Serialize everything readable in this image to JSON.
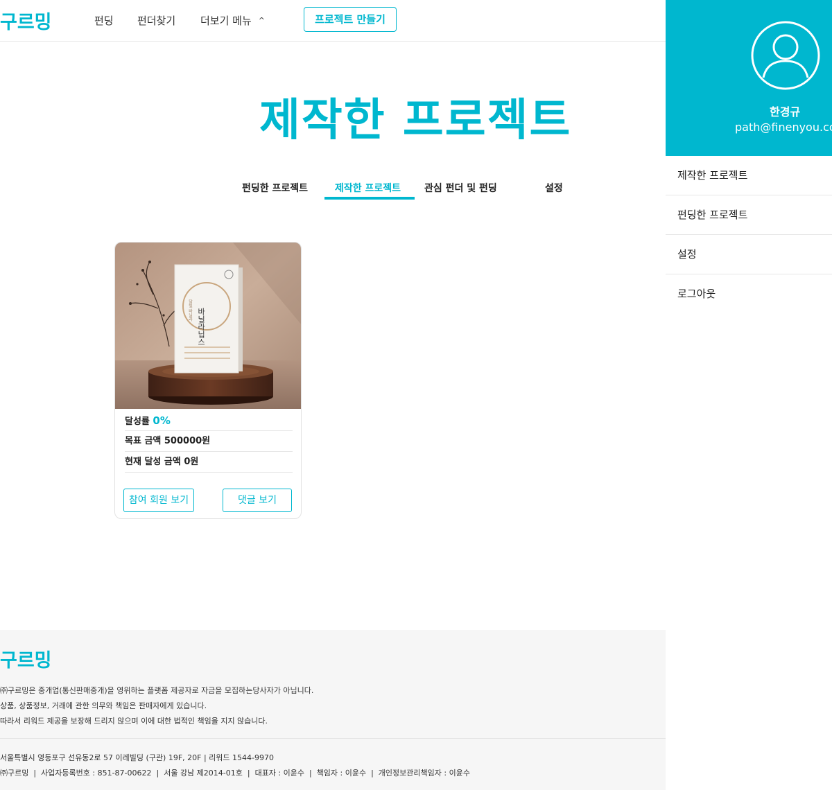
{
  "header": {
    "logo": "구르밍",
    "nav": [
      {
        "label": "펀딩"
      },
      {
        "label": "펀더찾기"
      },
      {
        "label": "더보기 메뉴"
      }
    ],
    "more_chevron_icon": "chevron-up-icon",
    "create_button": "프로젝트 만들기"
  },
  "page": {
    "title": "제작한 프로젝트",
    "tabs": [
      {
        "label": "펀딩한 프로젝트",
        "active": false
      },
      {
        "label": "제작한 프로젝트",
        "active": true
      },
      {
        "label": "관심 펀더 및 펀딩",
        "active": false
      },
      {
        "label": "설정",
        "active": false
      }
    ]
  },
  "project_card": {
    "image_text": {
      "product_name": "바닐라닙스",
      "tagline": "달빛 바닐라"
    },
    "rate_label": "달성률",
    "rate_value": "0%",
    "rate_fraction": 0,
    "goal_label": "목표 금액 500000원",
    "current_label": "현재 달성 금액 0원",
    "participants_button": "참여 회원 보기",
    "comments_button": "댓글 보기"
  },
  "sidebar": {
    "avatar_icon": "user-icon",
    "user_name": "한경규",
    "user_email": "path@finenyou.com",
    "items": [
      {
        "label": "제작한 프로젝트"
      },
      {
        "label": "펀딩한 프로젝트"
      },
      {
        "label": "설정"
      },
      {
        "label": "로그아웃"
      }
    ]
  },
  "footer": {
    "logo": "구르밍",
    "disclaimer": [
      "㈜구르밍은 중개업(통신판매중개)을 영위하는 플랫폼 제공자로 자금을 모집하는당사자가 아닙니다.",
      "상품, 상품정보, 거래에 관한 의무와 책임은 판매자에게 있습니다.",
      "따라서 리워드 제공을 보장해 드리지 않으며 이에 대한 법적인 책임을 지지 않습니다."
    ],
    "address": "서울특별시 영등포구 선유동2로 57 이레빌딩 (구관) 19F, 20F | 리워드 1544-9970",
    "company_info": "㈜구르밍  |  사업자등록번호 : 851-87-00622  |  서울 강남 제2014-01호  |  대표자 : 이윤수  |  책임자 : 이윤수  |  개인정보관리책임자 : 이윤수"
  },
  "colors": {
    "accent": "#00b7cf",
    "footer_bg": "#f6f6f6",
    "text": "#222222"
  }
}
